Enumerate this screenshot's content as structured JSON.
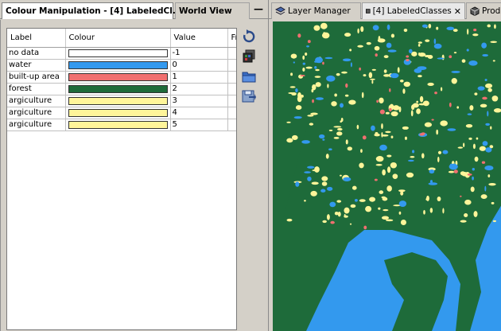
{
  "left_tabs": {
    "colour_manipulation": "Colour Manipulation - [4] LabeledCl...",
    "world_view": "World View",
    "close_glyph": "✕",
    "minimize_glyph": "—"
  },
  "table": {
    "headers": {
      "label": "Label",
      "colour": "Colour",
      "value": "Value",
      "extra": "Fr"
    },
    "rows": [
      {
        "label": "no data",
        "colour": "#ffffff",
        "value": "-1"
      },
      {
        "label": "water",
        "colour": "#3399ee",
        "value": "0"
      },
      {
        "label": "built-up area",
        "colour": "#f07070",
        "value": "1"
      },
      {
        "label": "forest",
        "colour": "#1e6b3a",
        "value": "2"
      },
      {
        "label": "argiculture",
        "colour": "#fff59a",
        "value": "3"
      },
      {
        "label": "argiculture",
        "colour": "#fff59a",
        "value": "4"
      },
      {
        "label": "argiculture",
        "colour": "#fff59a",
        "value": "5"
      }
    ]
  },
  "toolbar": {
    "icons": [
      "reset-icon",
      "import-colours-icon",
      "open-folder-icon",
      "export-icon"
    ]
  },
  "right_tabs": {
    "layer_manager": "Layer Manager",
    "labeled_classes": "[4] LabeledClasses",
    "product": "Produ",
    "close_glyph": "✕"
  },
  "map": {
    "palette": {
      "water": "#3399ee",
      "forest": "#1e6b3a",
      "agriculture": "#fff59a",
      "built_up": "#f07070"
    }
  }
}
